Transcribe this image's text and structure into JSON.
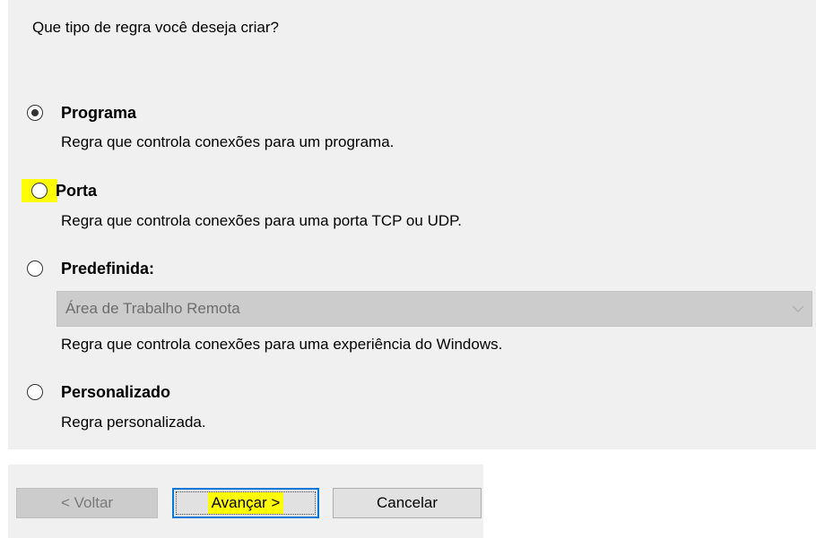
{
  "question": "Que tipo de regra você deseja criar?",
  "options": [
    {
      "label": "Programa",
      "description": "Regra que controla conexões para um programa.",
      "selected": true
    },
    {
      "label": "Porta",
      "description": "Regra que controla conexões para uma porta TCP ou UDP.",
      "selected": false
    },
    {
      "label": "Predefinida:",
      "description": "Regra que controla conexões para uma experiência do Windows.",
      "selected": false
    },
    {
      "label": "Personalizado",
      "description": "Regra personalizada.",
      "selected": false
    }
  ],
  "predefined_combo": {
    "value": "Área de Trabalho Remota",
    "disabled": true,
    "icon": "chevron-down-icon"
  },
  "buttons": {
    "back": "< Voltar",
    "next": "Avançar >",
    "cancel": "Cancelar"
  },
  "colors": {
    "highlight": "#ffff00",
    "focus_border": "#0078d7",
    "panel_bg": "#f0f0f0",
    "disabled_bg": "#cccccc"
  }
}
